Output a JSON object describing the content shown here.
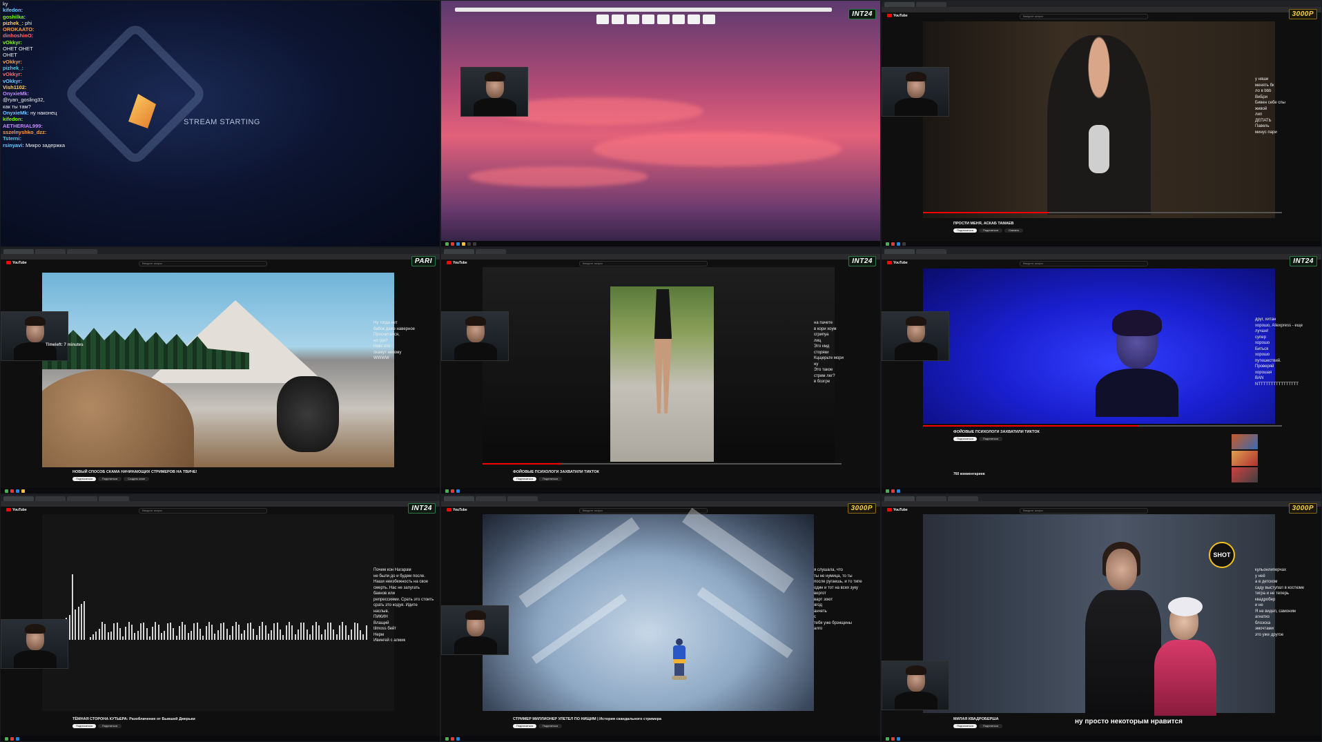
{
  "colors": {
    "accent": "#2a7a48",
    "gold": "#f5d142",
    "yt_red": "#ff0000"
  },
  "stream": {
    "start_text": "STREAM STARTING",
    "chat": [
      {
        "user": "",
        "text": "ky"
      },
      {
        "user": "kifedon:",
        "text": ""
      },
      {
        "user": "goshilka:",
        "text": ""
      },
      {
        "user": "pizhek_:",
        "text": "phi"
      },
      {
        "user": "",
        "text": ""
      },
      {
        "user": "OROKAATO:",
        "text": ""
      },
      {
        "user": "",
        "text": ""
      },
      {
        "user": "dinhoshinO:",
        "text": ""
      },
      {
        "user": "",
        "text": ""
      },
      {
        "user": "vOkkyr:",
        "text": ""
      },
      {
        "user": "",
        "text": "ОНЕТ ОНЕТ"
      },
      {
        "user": "",
        "text": "ОНЕТ"
      },
      {
        "user": "vOkkyr:",
        "text": ""
      },
      {
        "user": "pizhek_:",
        "text": ""
      },
      {
        "user": "vOkkyr:",
        "text": ""
      },
      {
        "user": "vOkkyr:",
        "text": ""
      },
      {
        "user": "",
        "text": ""
      },
      {
        "user": "Vish1102:",
        "text": ""
      },
      {
        "user": "OnyxieMk:",
        "text": ""
      },
      {
        "user": "",
        "text": "@ryan_gosling32,"
      },
      {
        "user": "",
        "text": "как ты там?"
      },
      {
        "user": "",
        "text": ""
      },
      {
        "user": "OnyxieMk:",
        "text": "ну наконец"
      },
      {
        "user": "kifedon:",
        "text": ""
      },
      {
        "user": "",
        "text": ""
      },
      {
        "user": "AETHERIAL999:",
        "text": ""
      },
      {
        "user": "sszelnyshko_dzz:",
        "text": ""
      },
      {
        "user": "Tsterni:",
        "text": ""
      },
      {
        "user": "",
        "text": ""
      },
      {
        "user": "rsinyavi:",
        "text": "Микро задержка"
      }
    ]
  },
  "badges": {
    "int24": "INT24",
    "pari": "PARI",
    "k3000": "3000P"
  },
  "youtube": {
    "logo": "YouTube",
    "search_placeholder": "Введите запрос",
    "subscribe": "Подписаться",
    "share": "Поделиться",
    "download": "Скачать",
    "clip": "Создать клип"
  },
  "cells": {
    "c3": {
      "title": "ПРОСТИ МЕНЯ, АСКАБ ТАМАЕВ",
      "chat": [
        {
          "user": "",
          "text": "у няши"
        },
        {
          "user": "",
          "text": "менять бк"
        },
        {
          "user": "",
          "text": "ло в bbb"
        },
        {
          "user": "",
          "text": ""
        },
        {
          "user": "",
          "text": "ВиБри"
        },
        {
          "user": "",
          "text": "Бивен себе спы"
        },
        {
          "user": "",
          "text": "живой"
        },
        {
          "user": "",
          "text": ""
        },
        {
          "user": "",
          "text": "лип"
        },
        {
          "user": "",
          "text": "ДЕПАТЬ"
        },
        {
          "user": "",
          "text": "Павель"
        },
        {
          "user": "",
          "text": "минус пари"
        }
      ]
    },
    "c4": {
      "title": "НОВЫЙ СПОСОБ СКАМА НАЧИНАЮЩИХ СТРИМЕРОВ НА ТВИЧЕ!",
      "timeleft": "Timeleft: 7 minutes",
      "chat": [
        {
          "user": "",
          "text": "Ну тогда нет"
        },
        {
          "user": "",
          "text": "бабок даже наверное"
        },
        {
          "user": "",
          "text": "Просчитался,"
        },
        {
          "user": "",
          "text": "но где?"
        },
        {
          "user": "",
          "text": ""
        },
        {
          "user": "",
          "text": "Никс это"
        },
        {
          "user": "",
          "text": ""
        },
        {
          "user": "",
          "text": "скажут некому"
        },
        {
          "user": "",
          "text": ""
        },
        {
          "user": "",
          "text": "WWWW"
        }
      ]
    },
    "c5": {
      "title": "ФОЙОВЫЕ ПСИХОЛОГИ ЗАХВАТИЛИ ТИКТОК",
      "chat": [
        {
          "user": "",
          "text": "на пачете"
        },
        {
          "user": "",
          "text": "в кори хоум"
        },
        {
          "user": "",
          "text": "сгрипуа"
        },
        {
          "user": "",
          "text": "лиц"
        },
        {
          "user": "",
          "text": "Это кмд"
        },
        {
          "user": "",
          "text": "сторяки"
        },
        {
          "user": "",
          "text": "Кцщерьте мори"
        },
        {
          "user": "",
          "text": "ну"
        },
        {
          "user": "",
          "text": "Это такое"
        },
        {
          "user": "",
          "text": "стрим лег?"
        },
        {
          "user": "",
          "text": ""
        },
        {
          "user": "",
          "text": "в бозгре"
        }
      ]
    },
    "c6": {
      "title": "ФОЙОВЫЕ ПСИХОЛОГИ ЗАХВАТИЛИ ТИКТОК",
      "comments": "760 комментариев",
      "chat": [
        {
          "user": "",
          "text": "друг, хитан"
        },
        {
          "user": "",
          "text": "хорошо, Aliexpress - еще"
        },
        {
          "user": "",
          "text": "лучше!"
        },
        {
          "user": "",
          "text": "супер"
        },
        {
          "user": "",
          "text": "хорошо"
        },
        {
          "user": "",
          "text": "Биться"
        },
        {
          "user": "",
          "text": "хорошо"
        },
        {
          "user": "",
          "text": "путешествий."
        },
        {
          "user": "",
          "text": "Проверяй"
        },
        {
          "user": "",
          "text": "хорошая"
        },
        {
          "user": "",
          "text": "BAN"
        },
        {
          "user": "",
          "text": "NTTTTTTTTTTTTTTTT"
        }
      ]
    },
    "c7": {
      "title": "ТЁМНАЯ СТОРОНА КУТЬЕРА: Разоблачение от Бывшей Джерьки",
      "chat": [
        {
          "user": "",
          "text": "Почем кон Нагарам"
        },
        {
          "user": "",
          "text": "не были до и будем после."
        },
        {
          "user": "",
          "text": "Наши неизбежность на свое"
        },
        {
          "user": "",
          "text": "смерть. Нас не запугать"
        },
        {
          "user": "",
          "text": "бакнов или"
        },
        {
          "user": "",
          "text": "репрессиями. Срать это стоить"
        },
        {
          "user": "",
          "text": "срать это кодуя. Идите"
        },
        {
          "user": "",
          "text": "наслыв."
        },
        {
          "user": "",
          "text": "ПИКИН"
        },
        {
          "user": "",
          "text": "Влащий"
        },
        {
          "user": "",
          "text": "tilmoss бейт"
        },
        {
          "user": "",
          "text": "Нерм"
        },
        {
          "user": "",
          "text": "Ивингей с алмик"
        }
      ]
    },
    "c8": {
      "title": "СТРИМЕР МИЛЛИОНЕР УЛЕТЕЛ ПО НИЩИМ | История скандального стримера",
      "chat": [
        {
          "user": "",
          "text": "я слушала, что"
        },
        {
          "user": "",
          "text": "ты не нумица, то ты"
        },
        {
          "user": "",
          "text": "после ругаешь, и то типе"
        },
        {
          "user": "",
          "text": "один и тот на всех зуку"
        },
        {
          "user": "",
          "text": "вергот"
        },
        {
          "user": "",
          "text": "варт зоют"
        },
        {
          "user": "",
          "text": "ягод"
        },
        {
          "user": "",
          "text": "анчеть"
        },
        {
          "user": "",
          "text": "с"
        },
        {
          "user": "",
          "text": "тебя уже брзнщины"
        },
        {
          "user": "",
          "text": "алго"
        }
      ]
    },
    "c9": {
      "title": "МИЛАЯ КВАДРОБЕРША",
      "subtitle": "ну просто некоторым нравится",
      "logo": "SHOT",
      "chat": [
        {
          "user": "",
          "text": "кульонлиперчах"
        },
        {
          "user": "",
          "text": "у неё"
        },
        {
          "user": "",
          "text": "а в детском"
        },
        {
          "user": "",
          "text": "саду выступал в костюме"
        },
        {
          "user": "",
          "text": "тигра и не теперь"
        },
        {
          "user": "",
          "text": "квадробер"
        },
        {
          "user": "",
          "text": "и не"
        },
        {
          "user": "",
          "text": "Я не видел, самоним"
        },
        {
          "user": "",
          "text": "агнатиз"
        },
        {
          "user": "",
          "text": "блоэска"
        },
        {
          "user": "",
          "text": "эмочтами"
        },
        {
          "user": "",
          "text": "это уже другое"
        }
      ]
    }
  }
}
